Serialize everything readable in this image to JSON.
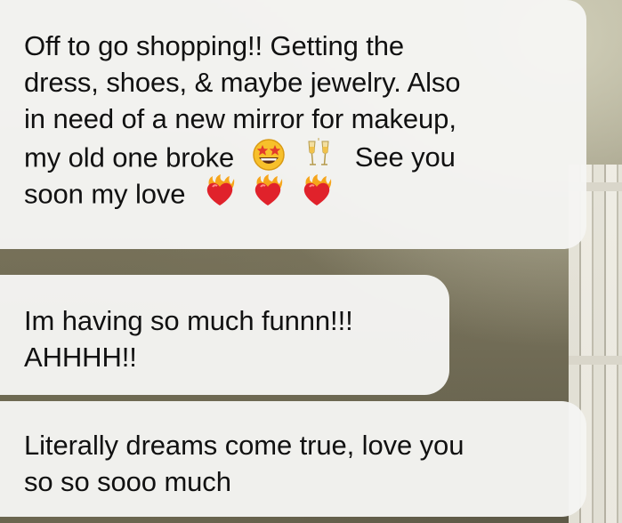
{
  "messages": [
    {
      "lines": [
        "Off to go shopping!! Getting the",
        "dress, shoes, & maybe jewelry. Also",
        "in need of a new mirror for makeup,",
        "my old one broke",
        "See you",
        "soon my love"
      ],
      "emojis": [
        "star-struck-face-icon",
        "clinking-glasses-icon",
        "heart-on-fire-icon"
      ]
    },
    {
      "lines": [
        "Im having so much funnn!!!",
        "AHHHH!!"
      ]
    },
    {
      "lines": [
        "Literally dreams come true, love you",
        "so so sooo much"
      ]
    }
  ],
  "colors": {
    "bubble": "#f5f5f3",
    "text": "#111111",
    "heart": "#e0222b",
    "flame": "#f6a51b"
  }
}
